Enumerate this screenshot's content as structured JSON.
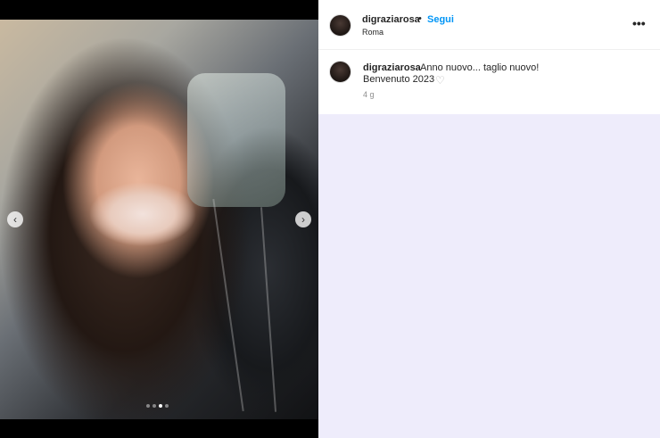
{
  "post": {
    "username": "digraziarosa",
    "separator": "•",
    "follow_label": "Segui",
    "location": "Roma",
    "more_label": "•••",
    "caption_line1": "Anno nuovo... taglio nuovo!",
    "caption_line2": "Benvenuto 2023",
    "heart_glyph": "♡",
    "time_ago": "4 g"
  },
  "carousel": {
    "prev_glyph": "‹",
    "next_glyph": "›",
    "dot_count": 4,
    "active_dot": 3
  },
  "colors": {
    "accent": "#0095f6",
    "background": "#eeecfb"
  }
}
